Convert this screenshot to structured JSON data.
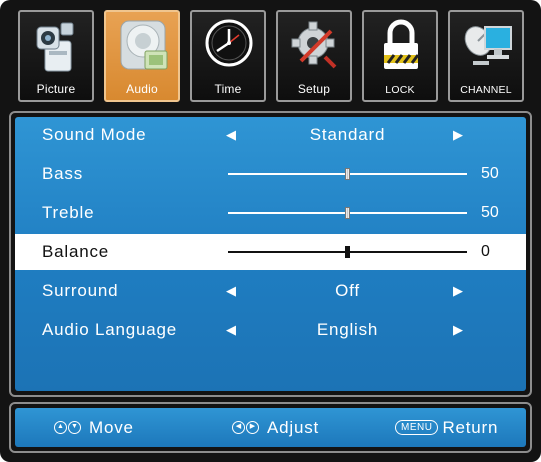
{
  "tabs": [
    {
      "label": "Picture",
      "icon": "camera-icon"
    },
    {
      "label": "Audio",
      "icon": "speaker-icon",
      "active": true
    },
    {
      "label": "Time",
      "icon": "clock-icon"
    },
    {
      "label": "Setup",
      "icon": "gear-wrench-icon"
    },
    {
      "label": "LOCK",
      "icon": "padlock-icon"
    },
    {
      "label": "CHANNEL",
      "icon": "satellite-monitor-icon"
    }
  ],
  "menu": {
    "sound_mode": {
      "label": "Sound Mode",
      "value": "Standard"
    },
    "bass": {
      "label": "Bass",
      "value": "50",
      "level": 0.5
    },
    "treble": {
      "label": "Treble",
      "value": "50",
      "level": 0.5
    },
    "balance": {
      "label": "Balance",
      "value": "0",
      "level": 0.5
    },
    "surround": {
      "label": "Surround",
      "value": "Off"
    },
    "audio_language": {
      "label": "Audio Language",
      "value": "English"
    }
  },
  "help": {
    "move": "Move",
    "adjust": "Adjust",
    "menu_key": "MENU",
    "return": "Return"
  },
  "colors": {
    "panel_blue": "#1f7dc1",
    "active_tab": "#e09640",
    "selected_row": "#ffffff"
  }
}
